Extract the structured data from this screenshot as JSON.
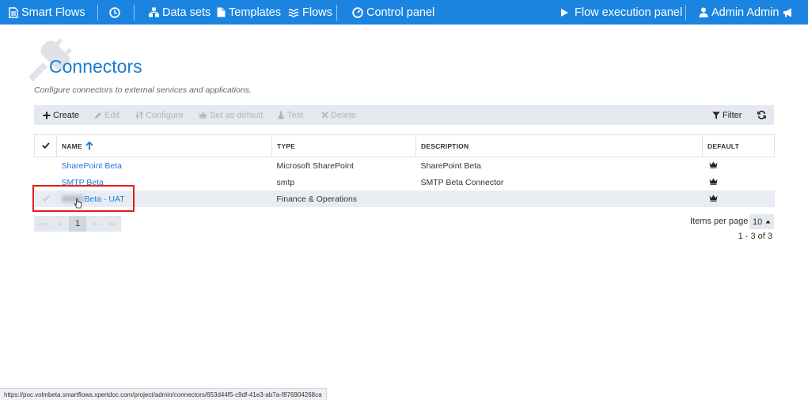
{
  "nav": {
    "brand": "Smart Flows",
    "datasets": "Data sets",
    "templates": "Templates",
    "flows": "Flows",
    "control_panel": "Control panel",
    "flow_execution": "Flow execution panel",
    "user": "Admin Admin"
  },
  "page": {
    "title": "Connectors",
    "subtitle": "Configure connectors to external services and applications."
  },
  "toolbar": {
    "create": "Create",
    "edit": "Edit",
    "configure": "Configure",
    "set_default": "Set as default",
    "test": "Test",
    "delete": "Delete",
    "filter": "Filter"
  },
  "table": {
    "headers": {
      "name": "NAME",
      "type": "TYPE",
      "description": "DESCRIPTION",
      "default": "DEFAULT"
    },
    "rows": [
      {
        "name": "SharePoint Beta",
        "type": "Microsoft SharePoint",
        "description": "SharePoint Beta",
        "default": true
      },
      {
        "name": "SMTP Beta",
        "type": "smtp",
        "description": "SMTP Beta Connector",
        "default": true
      },
      {
        "name": "Beta - UAT",
        "type": "Finance & Operations",
        "description": "",
        "default": true
      }
    ]
  },
  "pagination": {
    "first": "««",
    "prev": "«",
    "current": "1",
    "next": "»",
    "last": "»»",
    "items_per_page_label": "Items per page",
    "items_per_page": "10",
    "range": "1 - 3 of 3"
  },
  "status_url": "https://poc.volmbeta.smartflows.xpertdoc.com/project/admin/connectors/653d44f5-c9df-41e3-ab7a-f876904268ca",
  "colors": {
    "brand": "#1a84e0",
    "link": "#1a7ad6",
    "highlight": "#e41e1e"
  }
}
